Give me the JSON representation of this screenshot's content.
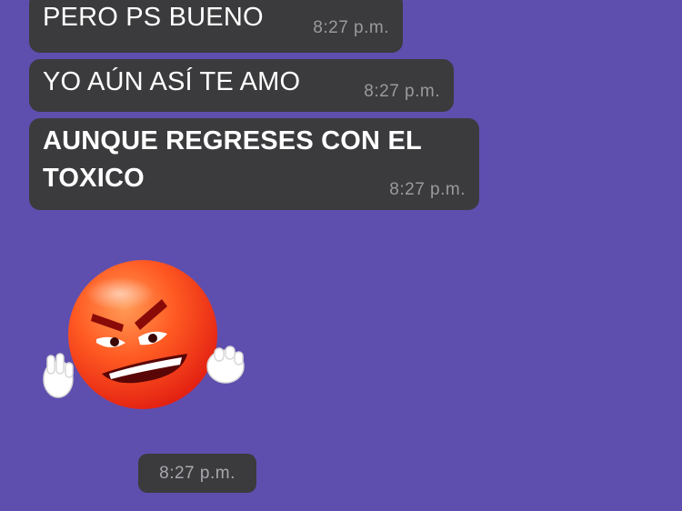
{
  "messages": [
    {
      "text": "PERO PS BUENO",
      "time": "8:27 p.m."
    },
    {
      "text": "YO AÚN ASÍ TE AMO",
      "time": "8:27 p.m."
    },
    {
      "text": "AUNQUE REGRESES CON EL TOXICO",
      "time": "8:27 p.m."
    }
  ],
  "sticker": {
    "icon": "angry-emoji-icon",
    "time": "8:27 p.m."
  },
  "colors": {
    "background": "#5e4faf",
    "bubble": "#3b3b3d",
    "timestamp": "#9a9a9e"
  }
}
